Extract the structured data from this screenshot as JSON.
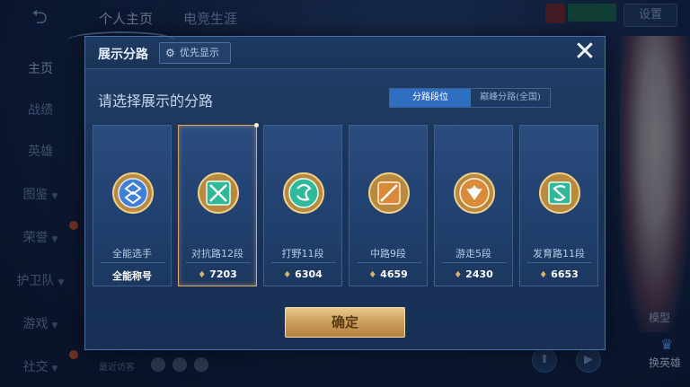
{
  "top_bar": {
    "tabs": [
      {
        "label": "个人主页"
      },
      {
        "label": "电竞生涯"
      }
    ],
    "settings_label": "设置"
  },
  "side_nav": {
    "items": [
      {
        "label": "主页"
      },
      {
        "label": "战绩"
      },
      {
        "label": "英雄"
      },
      {
        "label": "图鉴"
      },
      {
        "label": "荣誉"
      },
      {
        "label": "护卫队"
      },
      {
        "label": "游戏"
      },
      {
        "label": "社交"
      }
    ]
  },
  "background": {
    "hero_tag": "模型",
    "swap_hero": "换英雄",
    "visitors_label": "最近访客"
  },
  "modal": {
    "title": "展示分路",
    "priority_label": "优先显示",
    "subtitle": "请选择展示的分路",
    "segment": [
      {
        "label": "分路段位"
      },
      {
        "label": "巅峰分路(全国)"
      }
    ],
    "selected_segment": 0,
    "cards": [
      {
        "name": "全能选手",
        "score": "全能称号",
        "emblem": "all-round-emblem",
        "color": "#3f7fd6"
      },
      {
        "name": "对抗路12段",
        "score": "7203",
        "emblem": "clash-lane-emblem",
        "color": "#2fb89a"
      },
      {
        "name": "打野11段",
        "score": "6304",
        "emblem": "jungle-emblem",
        "color": "#2fb89a"
      },
      {
        "name": "中路9段",
        "score": "4659",
        "emblem": "mid-lane-emblem",
        "color": "#d98a3a"
      },
      {
        "name": "游走5段",
        "score": "2430",
        "emblem": "roam-emblem",
        "color": "#d98a3a"
      },
      {
        "name": "发育路11段",
        "score": "6653",
        "emblem": "farm-lane-emblem",
        "color": "#2fb89a"
      }
    ],
    "selected_card": 1,
    "confirm_label": "确定"
  }
}
